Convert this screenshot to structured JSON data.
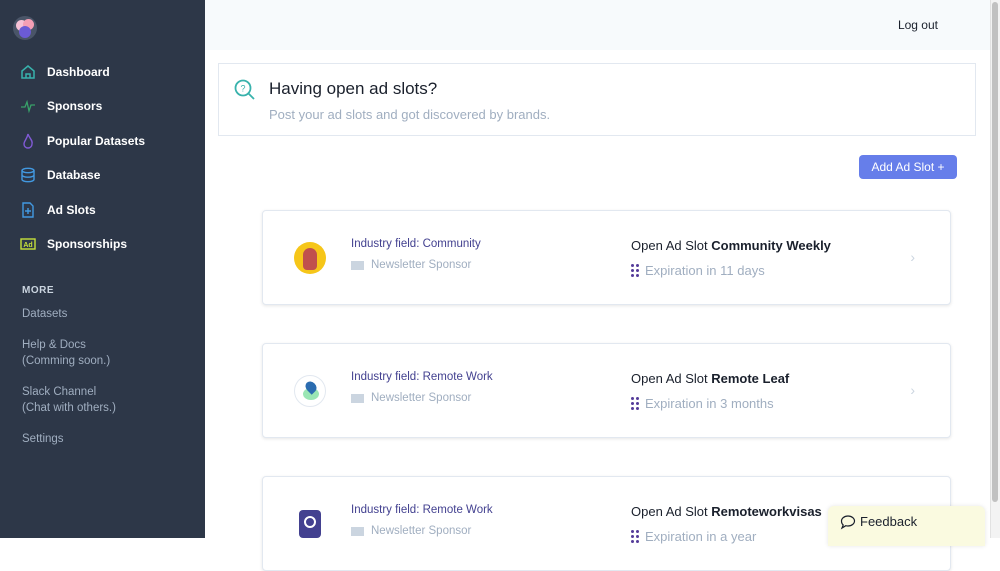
{
  "sidebar": {
    "items": [
      {
        "label": "Dashboard",
        "icon": "home-icon",
        "color": "#38b2ac"
      },
      {
        "label": "Sponsors",
        "icon": "activity-icon",
        "color": "#38a169"
      },
      {
        "label": "Popular Datasets",
        "icon": "flame-icon",
        "color": "#805ad5"
      },
      {
        "label": "Database",
        "icon": "database-icon",
        "color": "#4299e1"
      },
      {
        "label": "Ad Slots",
        "icon": "file-plus-icon",
        "color": "#4299e1"
      },
      {
        "label": "Sponsorships",
        "icon": "ad-icon",
        "color": "#c6e03a"
      }
    ],
    "more_label": "MORE",
    "sub": [
      {
        "l1": "Datasets"
      },
      {
        "l1": "Help & Docs",
        "l2": "(Comming soon.)"
      },
      {
        "l1": "Slack Channel",
        "l2": "(Chat with others.)"
      },
      {
        "l1": "Settings"
      }
    ]
  },
  "header": {
    "logout": "Log out"
  },
  "banner": {
    "title": "Having open ad slots?",
    "subtitle": "Post your ad slots and got discovered by brands."
  },
  "add_button": "Add Ad Slot +",
  "cards": [
    {
      "industry": "Industry field: Community",
      "type": "Newsletter Sponsor",
      "prefix": "Open Ad Slot ",
      "name": "Community Weekly",
      "expiration": "Expiration in 11 days"
    },
    {
      "industry": "Industry field: Remote Work",
      "type": "Newsletter Sponsor",
      "prefix": "Open Ad Slot ",
      "name": "Remote Leaf",
      "expiration": "Expiration in 3 months"
    },
    {
      "industry": "Industry field: Remote Work",
      "type": "Newsletter Sponsor",
      "prefix": "Open Ad Slot ",
      "name": "Remoteworkvisas",
      "expiration": "Expiration in a year"
    }
  ],
  "feedback": "Feedback"
}
